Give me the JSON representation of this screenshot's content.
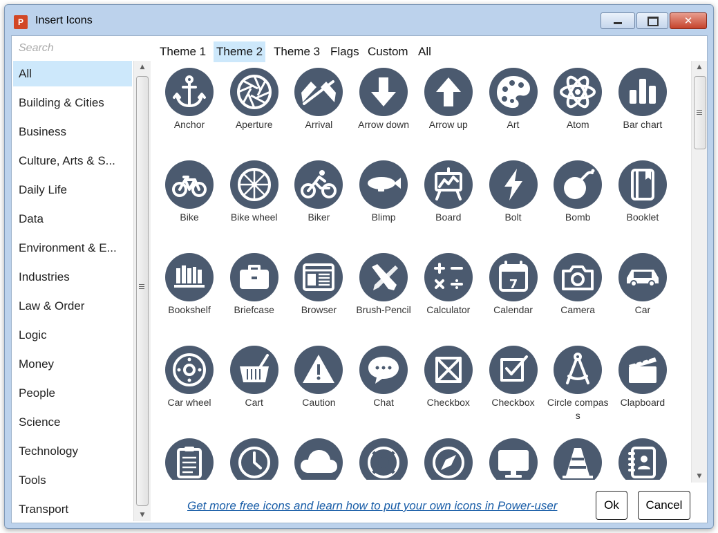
{
  "window": {
    "title": "Insert Icons",
    "app_icon_letter": "P",
    "close_glyph": "✕"
  },
  "search": {
    "placeholder": "Search",
    "value": ""
  },
  "categories": [
    {
      "label": "All",
      "selected": true
    },
    {
      "label": "Building & Cities"
    },
    {
      "label": "Business"
    },
    {
      "label": "Culture, Arts & S..."
    },
    {
      "label": "Daily Life"
    },
    {
      "label": "Data"
    },
    {
      "label": "Environment & E..."
    },
    {
      "label": "Industries"
    },
    {
      "label": "Law & Order"
    },
    {
      "label": "Logic"
    },
    {
      "label": "Money"
    },
    {
      "label": "People"
    },
    {
      "label": "Science"
    },
    {
      "label": "Technology"
    },
    {
      "label": "Tools"
    },
    {
      "label": "Transport"
    }
  ],
  "tabs": [
    {
      "label": "Theme 1"
    },
    {
      "label": "Theme 2",
      "active": true
    },
    {
      "label": "Theme 3"
    },
    {
      "label": "Flags"
    },
    {
      "label": "Custom"
    },
    {
      "label": "All"
    }
  ],
  "icons": [
    {
      "label": "Anchor",
      "icon": "anchor-icon"
    },
    {
      "label": "Aperture",
      "icon": "aperture-icon"
    },
    {
      "label": "Arrival",
      "icon": "arrival-flags-icon"
    },
    {
      "label": "Arrow down",
      "icon": "arrow-down-icon"
    },
    {
      "label": "Arrow up",
      "icon": "arrow-up-icon"
    },
    {
      "label": "Art",
      "icon": "art-palette-icon"
    },
    {
      "label": "Atom",
      "icon": "atom-icon"
    },
    {
      "label": "Bar chart",
      "icon": "bar-chart-icon"
    },
    {
      "label": "Bike",
      "icon": "bike-icon"
    },
    {
      "label": "Bike wheel",
      "icon": "bike-wheel-icon"
    },
    {
      "label": "Biker",
      "icon": "biker-icon"
    },
    {
      "label": "Blimp",
      "icon": "blimp-icon"
    },
    {
      "label": "Board",
      "icon": "board-icon"
    },
    {
      "label": "Bolt",
      "icon": "bolt-icon"
    },
    {
      "label": "Bomb",
      "icon": "bomb-icon"
    },
    {
      "label": "Booklet",
      "icon": "booklet-icon"
    },
    {
      "label": "Bookshelf",
      "icon": "bookshelf-icon"
    },
    {
      "label": "Briefcase",
      "icon": "briefcase-icon"
    },
    {
      "label": "Browser",
      "icon": "browser-icon"
    },
    {
      "label": "Brush-Pencil",
      "icon": "brush-pencil-icon"
    },
    {
      "label": "Calculator",
      "icon": "calculator-icon"
    },
    {
      "label": "Calendar",
      "icon": "calendar-icon",
      "text": "7"
    },
    {
      "label": "Camera",
      "icon": "camera-icon"
    },
    {
      "label": "Car",
      "icon": "car-icon"
    },
    {
      "label": "Car wheel",
      "icon": "car-wheel-icon"
    },
    {
      "label": "Cart",
      "icon": "cart-icon"
    },
    {
      "label": "Caution",
      "icon": "caution-icon"
    },
    {
      "label": "Chat",
      "icon": "chat-icon"
    },
    {
      "label": "Checkbox",
      "icon": "checkbox-crossed-icon"
    },
    {
      "label": "Checkbox",
      "icon": "checkbox-checked-icon"
    },
    {
      "label": "Circle compass",
      "icon": "circle-compass-icon"
    },
    {
      "label": "Clapboard",
      "icon": "clapboard-icon"
    },
    {
      "label": "",
      "icon": "clipboard-icon"
    },
    {
      "label": "",
      "icon": "clock-icon"
    },
    {
      "label": "",
      "icon": "cloud-icon"
    },
    {
      "label": "",
      "icon": "lifebuoy-icon"
    },
    {
      "label": "",
      "icon": "compass-icon"
    },
    {
      "label": "",
      "icon": "monitor-icon"
    },
    {
      "label": "",
      "icon": "cone-icon"
    },
    {
      "label": "",
      "icon": "contacts-book-icon"
    }
  ],
  "footer": {
    "link_text": "Get more free icons and learn how to put your own icons in Power-user",
    "ok_label": "Ok",
    "cancel_label": "Cancel"
  },
  "colors": {
    "icon_circle": "#4b5a6f",
    "selection": "#cde8fb",
    "link": "#1a5ea8"
  }
}
